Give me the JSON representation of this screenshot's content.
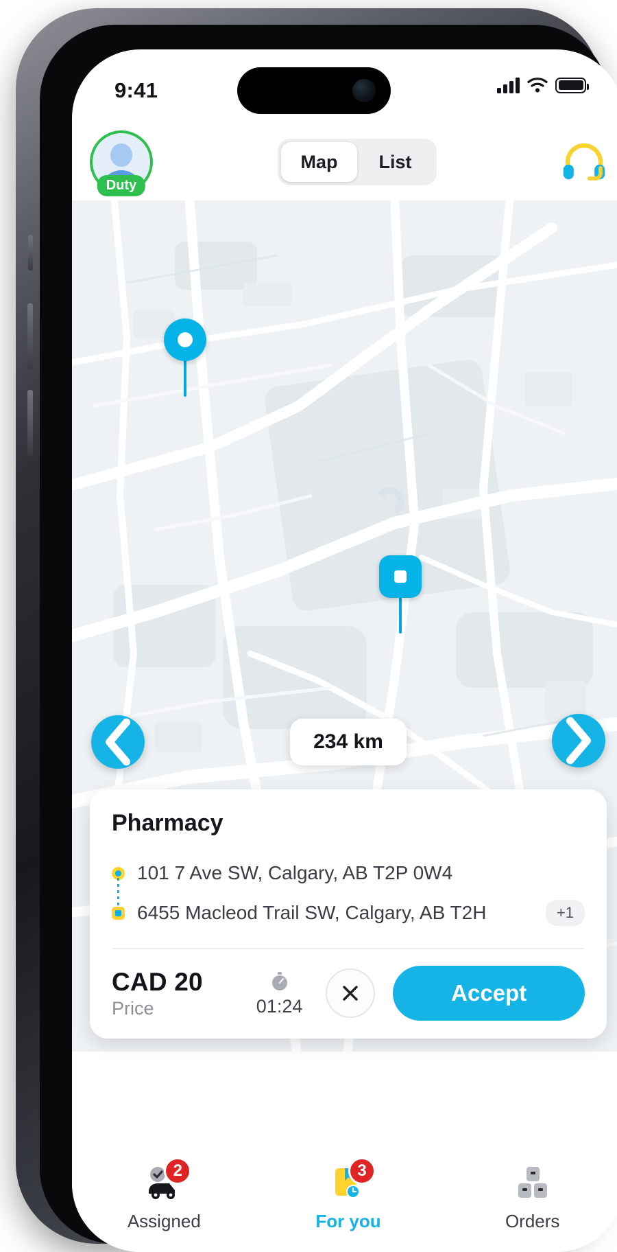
{
  "status_bar": {
    "time": "9:41",
    "signal_icon": "cellular-signal-icon",
    "wifi_icon": "wifi-icon",
    "battery_icon": "battery-icon"
  },
  "header": {
    "avatar_icon": "avatar",
    "duty_badge": "Duty",
    "segmented": {
      "options": [
        "Map",
        "List"
      ],
      "selected": "Map"
    },
    "support_icon": "headset-icon"
  },
  "map": {
    "distance_chip": "234 km",
    "prev_icon": "chevron-left-icon",
    "next_icon": "chevron-right-icon",
    "pickup_marker": "pickup-pin",
    "dropoff_marker": "dropoff-pin"
  },
  "order_card": {
    "title": "Pharmacy",
    "stops": [
      {
        "type": "pickup",
        "address": "101 7 Ave SW, Calgary, AB T2P 0W4"
      },
      {
        "type": "dropoff",
        "address": "6455 Macleod Trail SW, Calgary, AB T2H"
      }
    ],
    "more_stops_badge": "+1",
    "price_value": "CAD 20",
    "price_label": "Price",
    "timer_icon": "stopwatch-icon",
    "timer_value": "01:24",
    "reject_icon": "close-icon",
    "accept_label": "Accept"
  },
  "tab_bar": {
    "tabs": [
      {
        "label": "Assigned",
        "badge": "2",
        "icon": "assigned-vehicle-icon",
        "active": false
      },
      {
        "label": "For you",
        "badge": "3",
        "icon": "offer-package-icon",
        "active": true
      },
      {
        "label": "Orders",
        "badge": "",
        "icon": "boxes-icon",
        "active": false
      }
    ]
  },
  "colors": {
    "accent": "#16b3e6",
    "duty_green": "#2fbf4f",
    "badge_red": "#e02424",
    "marker_yellow": "#ffd22e"
  }
}
